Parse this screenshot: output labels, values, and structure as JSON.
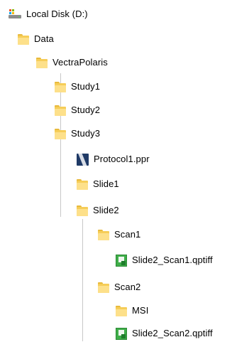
{
  "tree": {
    "drive": {
      "label": "Local Disk (D:)",
      "icon": "drive-icon"
    },
    "data_folder": {
      "label": "Data",
      "icon": "folder-icon"
    },
    "vectrapolaris_folder": {
      "label": "VectraPolaris",
      "icon": "folder-icon"
    },
    "study1_folder": {
      "label": "Study1",
      "icon": "folder-icon"
    },
    "study2_folder": {
      "label": "Study2",
      "icon": "folder-icon"
    },
    "study3_folder": {
      "label": "Study3",
      "icon": "folder-icon"
    },
    "protocol_file": {
      "label": "Protocol1.ppr",
      "icon": "protocol-file-icon"
    },
    "slide1_folder": {
      "label": "Slide1",
      "icon": "folder-icon"
    },
    "slide2_folder": {
      "label": "Slide2",
      "icon": "folder-icon"
    },
    "scan1_folder": {
      "label": "Scan1",
      "icon": "folder-icon"
    },
    "scan1_file": {
      "label": "Slide2_Scan1.qptiff",
      "icon": "qptiff-file-icon"
    },
    "scan2_folder": {
      "label": "Scan2",
      "icon": "folder-icon"
    },
    "msi_folder": {
      "label": "MSI",
      "icon": "folder-icon"
    },
    "scan2_file": {
      "label": "Slide2_Scan2.qptiff",
      "icon": "qptiff-file-icon"
    }
  },
  "colors": {
    "folder_back": "#f6cd58",
    "folder_front": "#fde08a",
    "folder_tab": "#e8b93b",
    "tree_line": "#c8c8c8",
    "protocol_icon": "#1f3a66",
    "qptiff_icon": "#3fae49"
  }
}
